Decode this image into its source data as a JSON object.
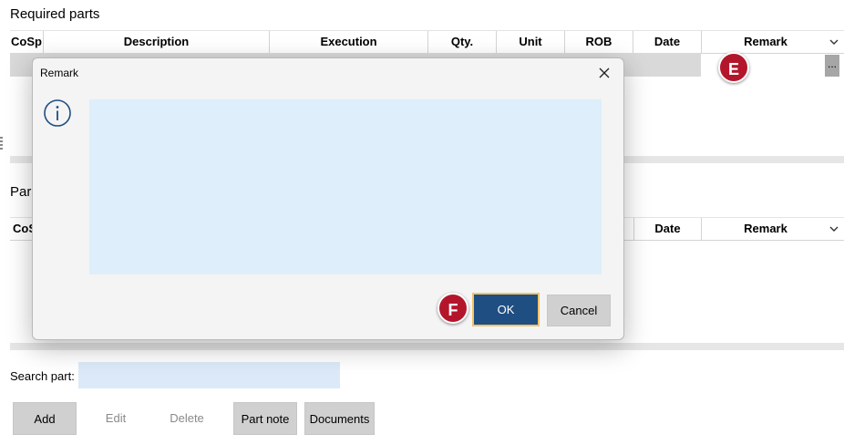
{
  "required_parts": {
    "title": "Required parts",
    "columns": [
      "CoSp",
      "Description",
      "Execution",
      "Qty.",
      "Unit",
      "ROB",
      "Date",
      "Remark"
    ],
    "row_button": "..."
  },
  "parts_section": {
    "title": "Par",
    "columns": [
      "CoS",
      "Date",
      "Remark"
    ]
  },
  "search": {
    "label": "Search part:",
    "value": ""
  },
  "buttons": {
    "add": "Add",
    "edit": "Edit",
    "delete": "Delete",
    "part_note": "Part note",
    "documents": "Documents"
  },
  "dialog": {
    "title": "Remark",
    "text_value": "",
    "ok": "OK",
    "cancel": "Cancel"
  },
  "callouts": {
    "e": "E",
    "f": "F"
  },
  "colors": {
    "callout": "#b3162b",
    "ok_button": "#1f4e82",
    "ok_focus": "#f2c36b",
    "text_area": "#deeefb",
    "search_field": "#dce9f8"
  }
}
